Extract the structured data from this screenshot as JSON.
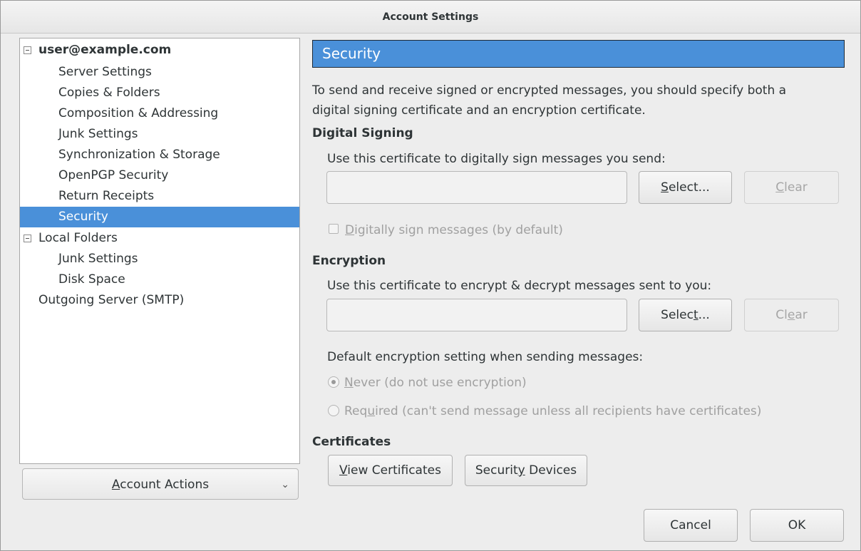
{
  "window": {
    "title": "Account Settings"
  },
  "tree": {
    "items": [
      {
        "label": "user@example.com",
        "level": 0,
        "expander": true,
        "bold": true
      },
      {
        "label": "Server Settings",
        "level": 1
      },
      {
        "label": "Copies & Folders",
        "level": 1
      },
      {
        "label": "Composition & Addressing",
        "level": 1
      },
      {
        "label": "Junk Settings",
        "level": 1
      },
      {
        "label": "Synchronization & Storage",
        "level": 1
      },
      {
        "label": "OpenPGP Security",
        "level": 1
      },
      {
        "label": "Return Receipts",
        "level": 1
      },
      {
        "label": "Security",
        "level": 1,
        "selected": true
      },
      {
        "label": "Local Folders",
        "level": 0,
        "expander": true
      },
      {
        "label": "Junk Settings",
        "level": 1
      },
      {
        "label": "Disk Space",
        "level": 1
      },
      {
        "label": "Outgoing Server (SMTP)",
        "level": 0
      }
    ]
  },
  "account_actions": {
    "label_accel": "A",
    "label_rest": "ccount Actions"
  },
  "panel": {
    "title": "Security",
    "intro_line1": "To send and receive signed or encrypted messages, you should specify both a",
    "intro_line2": "digital signing certificate and an encryption certificate.",
    "signing": {
      "heading": "Digital Signing",
      "prompt": "Use this certificate to digitally sign messages you send:",
      "select": {
        "pre": "",
        "accel": "S",
        "post": "elect..."
      },
      "clear": {
        "pre": "",
        "accel": "C",
        "post": "lear"
      },
      "checkbox": {
        "pre": "",
        "accel": "D",
        "post": "igitally sign messages (by default)",
        "checked": false
      }
    },
    "encryption": {
      "heading": "Encryption",
      "prompt": "Use this certificate to encrypt & decrypt messages sent to you:",
      "select": {
        "pre": "Selec",
        "accel": "t",
        "post": "..."
      },
      "clear": {
        "pre": "Cl",
        "accel": "e",
        "post": "ar"
      },
      "default_label": "Default encryption setting when sending messages:",
      "never": {
        "pre": "",
        "accel": "N",
        "post": "ever (do not use encryption)",
        "selected": true
      },
      "required": {
        "pre": "Req",
        "accel": "u",
        "post": "ired (can't send message unless all recipients have certificates)",
        "selected": false
      }
    },
    "certificates": {
      "heading": "Certificates",
      "view": {
        "pre": "",
        "accel": "V",
        "post": "iew Certificates"
      },
      "devices": {
        "pre": "Securit",
        "accel": "y",
        "post": " Devices"
      }
    }
  },
  "footer": {
    "cancel": "Cancel",
    "ok": "OK"
  },
  "colors": {
    "accent": "#4a90d9",
    "window_bg": "#ededed"
  }
}
